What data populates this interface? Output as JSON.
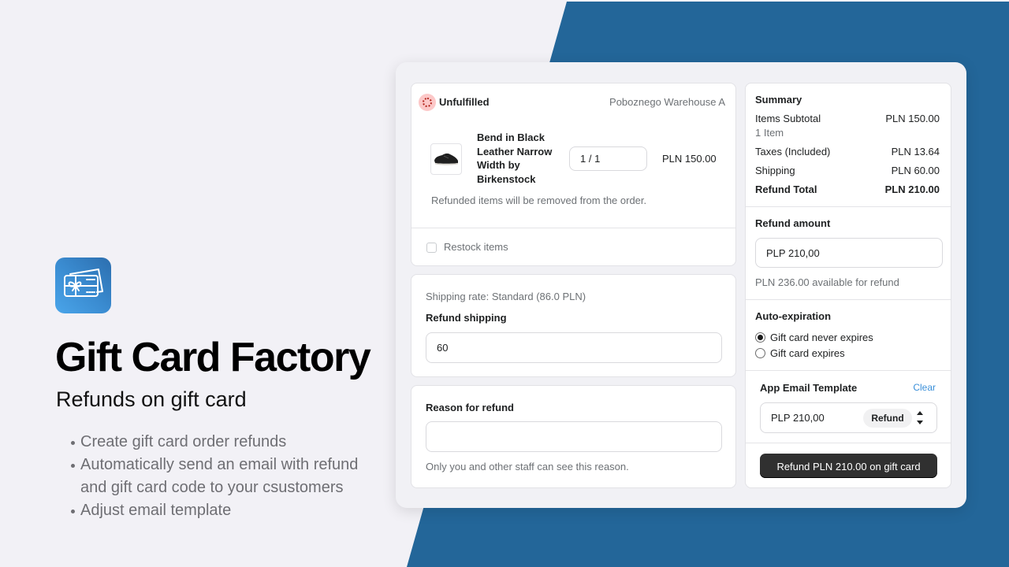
{
  "colors": {
    "background": "#f2f1f6",
    "brand_blue": "#236699",
    "link_blue": "#3a8fd9",
    "primary_button": "#303030",
    "unfulfilled_badge": "#fcc8c8"
  },
  "hero": {
    "app_icon": "gift-card-icon",
    "title": "Gift Card Factory",
    "subtitle": "Refunds on gift card",
    "features": [
      "Create gift card order refunds",
      "Automatically send an email with refund and gift card code to your csustomers",
      "Adjust email template"
    ]
  },
  "fulfillment": {
    "status": "Unfulfilled",
    "status_icon": "unfulfilled-icon",
    "location": "Poboznego Warehouse A",
    "item": {
      "image": "shoe-thumbnail",
      "name": "Bend in Black Leather Narrow Width by Birkenstock",
      "quantity": "1 / 1",
      "price": "PLN 150.00"
    },
    "note": "Refunded items will be removed from the order.",
    "restock": {
      "label": "Restock items",
      "checked": false
    }
  },
  "shipping": {
    "rate": "Shipping rate: Standard (86.0 PLN)",
    "label": "Refund shipping",
    "value": "60"
  },
  "reason": {
    "label": "Reason for refund",
    "value": "",
    "helper": "Only you and other staff can see this reason."
  },
  "summary": {
    "title": "Summary",
    "rows": [
      {
        "label": "Items Subtotal",
        "value": "PLN 150.00",
        "sub": "1 Item"
      },
      {
        "label": "Taxes (Included)",
        "value": "PLN 13.64"
      },
      {
        "label": "Shipping",
        "value": "PLN 60.00"
      },
      {
        "label": "Refund Total",
        "value": "PLN 210.00"
      }
    ]
  },
  "refund_amount": {
    "label": "Refund amount",
    "value": "PLP 210,00",
    "available": "PLN 236.00 available for refund"
  },
  "auto_expiration": {
    "label": "Auto-expiration",
    "options": [
      {
        "label": "Gift card never expires",
        "selected": true
      },
      {
        "label": "Gift card expires",
        "selected": false
      }
    ]
  },
  "email_template": {
    "label": "App Email Template",
    "clear_label": "Clear",
    "value": "PLP 210,00",
    "selected_template": "Refund"
  },
  "submit": {
    "label": "Refund PLN 210.00 on gift card"
  }
}
